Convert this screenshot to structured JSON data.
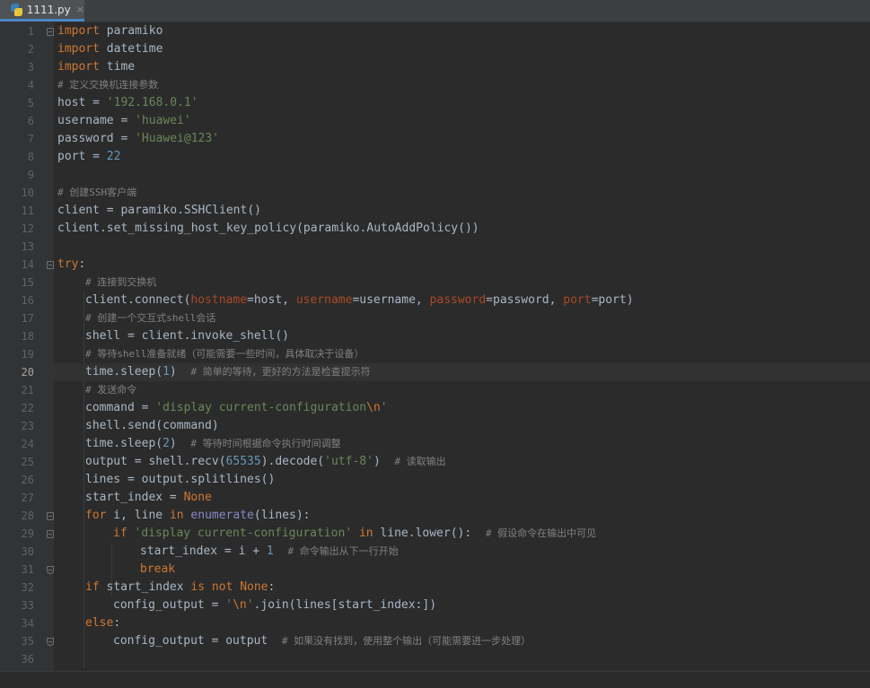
{
  "tab": {
    "filename": "1111.py",
    "close": "×"
  },
  "editor": {
    "current_line": 20,
    "lines": [
      "1",
      "2",
      "3",
      "4",
      "5",
      "6",
      "7",
      "8",
      "9",
      "10",
      "11",
      "12",
      "13",
      "14",
      "15",
      "16",
      "17",
      "18",
      "19",
      "20",
      "21",
      "22",
      "23",
      "24",
      "25",
      "26",
      "27",
      "28",
      "29",
      "30",
      "31",
      "32",
      "33",
      "34",
      "35",
      "36"
    ]
  },
  "code": {
    "l1": [
      "import",
      " paramiko"
    ],
    "l2": [
      "import",
      " datetime"
    ],
    "l3": [
      "import",
      " time"
    ],
    "l4": "# 定义交换机连接参数",
    "l5": [
      "host = ",
      "'192.168.0.1'"
    ],
    "l6": [
      "username = ",
      "'huawei'"
    ],
    "l7": [
      "password = ",
      "'Huawei@123'"
    ],
    "l8": [
      "port = ",
      "22"
    ],
    "l10": "# 创建SSH客户端",
    "l11": "client = paramiko.SSHClient()",
    "l12": "client.set_missing_host_key_policy(paramiko.AutoAddPolicy())",
    "l14": [
      "try",
      ":"
    ],
    "l15": "# 连接到交换机",
    "l16": [
      "client.connect(",
      "hostname",
      "=host, ",
      "username",
      "=username, ",
      "password",
      "=password, ",
      "port",
      "=port)"
    ],
    "l17": "# 创建一个交互式shell会话",
    "l18": "shell = client.invoke_shell()",
    "l19": "# 等待shell准备就绪（可能需要一些时间，具体取决于设备）",
    "l20": [
      "time.sleep(",
      "1",
      ")  ",
      "# 简单的等待，更好的方法是检查提示符"
    ],
    "l21": "# 发送命令",
    "l22": [
      "command = ",
      "'display current-configuration",
      "\\n",
      "'"
    ],
    "l23": "shell.send(command)",
    "l24": [
      "time.sleep(",
      "2",
      ")  ",
      "# 等待时间根据命令执行时间调整"
    ],
    "l25": [
      "output = shell.recv(",
      "65535",
      ").decode(",
      "'utf-8'",
      ")  ",
      "# 读取输出"
    ],
    "l26": "lines = output.splitlines()",
    "l27": [
      "start_index = ",
      "None"
    ],
    "l28": [
      "for",
      " i, line ",
      "in",
      " ",
      "enumerate",
      "(lines):"
    ],
    "l29": [
      "if",
      " ",
      "'display current-configuration'",
      " ",
      "in",
      " line.lower():  ",
      "# 假设命令在输出中可见"
    ],
    "l30": [
      "start_index = i + ",
      "1",
      "  ",
      "# 命令输出从下一行开始"
    ],
    "l31": "break",
    "l32": [
      "if",
      " start_index ",
      "is not",
      " ",
      "None",
      ":"
    ],
    "l33": [
      "config_output = ",
      "'",
      "\\n",
      "'",
      ".join(lines[start_index:])"
    ],
    "l34": [
      "else",
      ":"
    ],
    "l35": [
      "config_output = output  ",
      "# 如果没有找到，使用整个输出（可能需要进一步处理）"
    ]
  }
}
